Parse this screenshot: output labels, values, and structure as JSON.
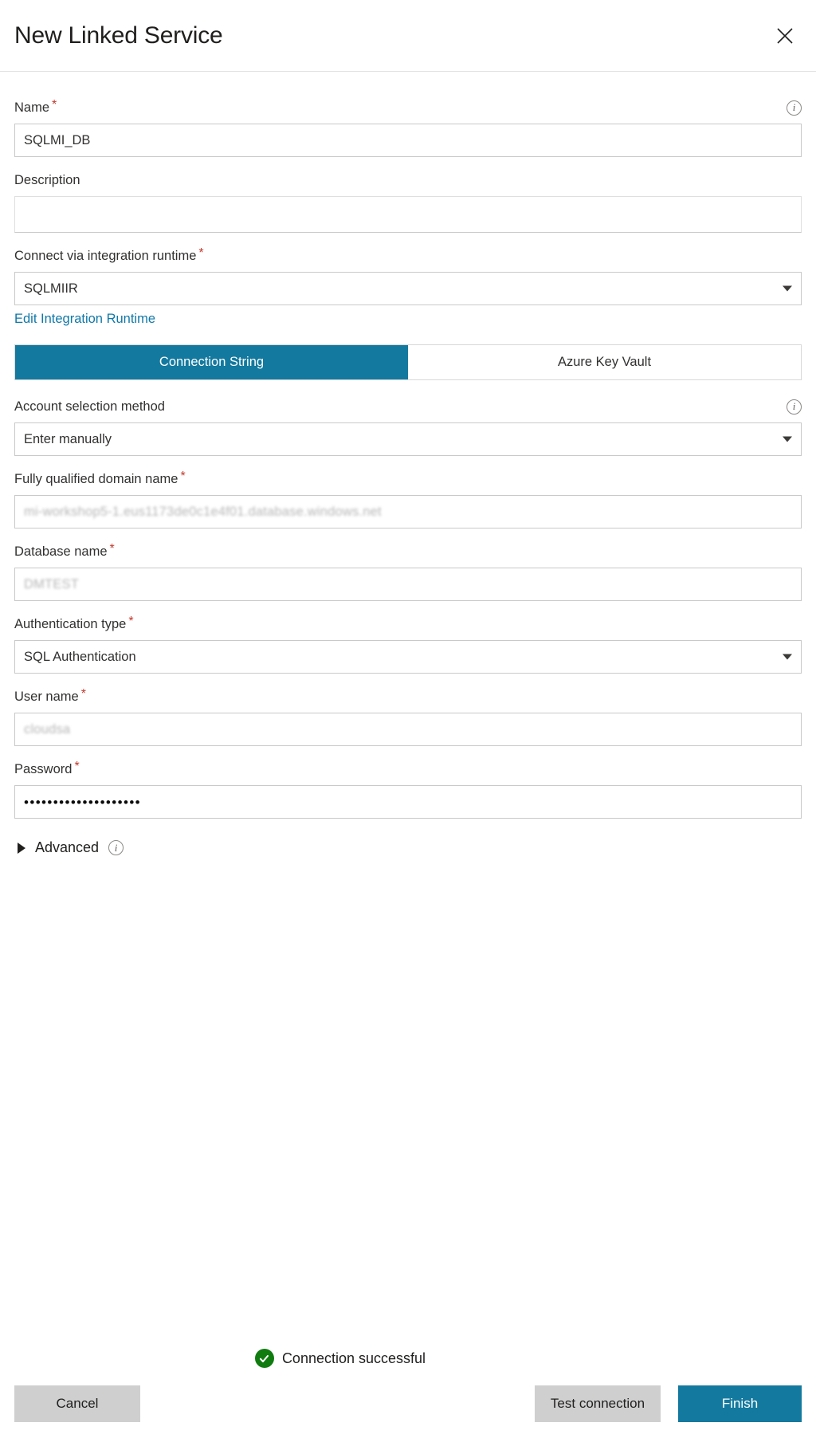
{
  "header": {
    "title": "New Linked Service",
    "close_icon": "close-icon"
  },
  "form": {
    "name": {
      "label": "Name",
      "required": "*",
      "value": "SQLMI_DB",
      "info_icon": "info-icon"
    },
    "description": {
      "label": "Description",
      "value": "",
      "placeholder": ""
    },
    "integration_runtime": {
      "label": "Connect via integration runtime",
      "required": "*",
      "value": "SQLMIIR",
      "caret_icon": "chevron-down-icon"
    },
    "edit_runtime_link": "Edit Integration Runtime",
    "tabs": [
      {
        "label": "Connection String",
        "active": true
      },
      {
        "label": "Azure Key Vault",
        "active": false
      }
    ],
    "account_selection": {
      "label": "Account selection method",
      "value": "Enter manually",
      "info_icon": "info-icon",
      "caret_icon": "chevron-down-icon"
    },
    "fqdn": {
      "label": "Fully qualified domain name",
      "required": "*",
      "value": "mi-workshop5-1.eus1173de0c1e4f01.database.windows.net",
      "redacted": true
    },
    "database_name": {
      "label": "Database name",
      "required": "*",
      "value": "DMTEST",
      "redacted": true
    },
    "auth_type": {
      "label": "Authentication type",
      "required": "*",
      "value": "SQL Authentication",
      "caret_icon": "chevron-down-icon"
    },
    "user_name": {
      "label": "User name",
      "required": "*",
      "value": "cloudsa",
      "redacted": true
    },
    "password": {
      "label": "Password",
      "required": "*",
      "value": "••••••••••••••••••••"
    },
    "advanced": {
      "label": "Advanced",
      "expanded": false,
      "toggle_icon": "triangle-right-icon",
      "info_icon": "info-icon"
    }
  },
  "footer": {
    "status": {
      "text": "Connection successful",
      "icon": "check-circle-icon",
      "color": "#107c10"
    },
    "cancel_label": "Cancel",
    "test_connection_label": "Test connection",
    "finish_label": "Finish"
  },
  "colors": {
    "accent": "#13799f",
    "link": "#0f78a8",
    "required": "#c0392b",
    "success": "#107c10"
  }
}
